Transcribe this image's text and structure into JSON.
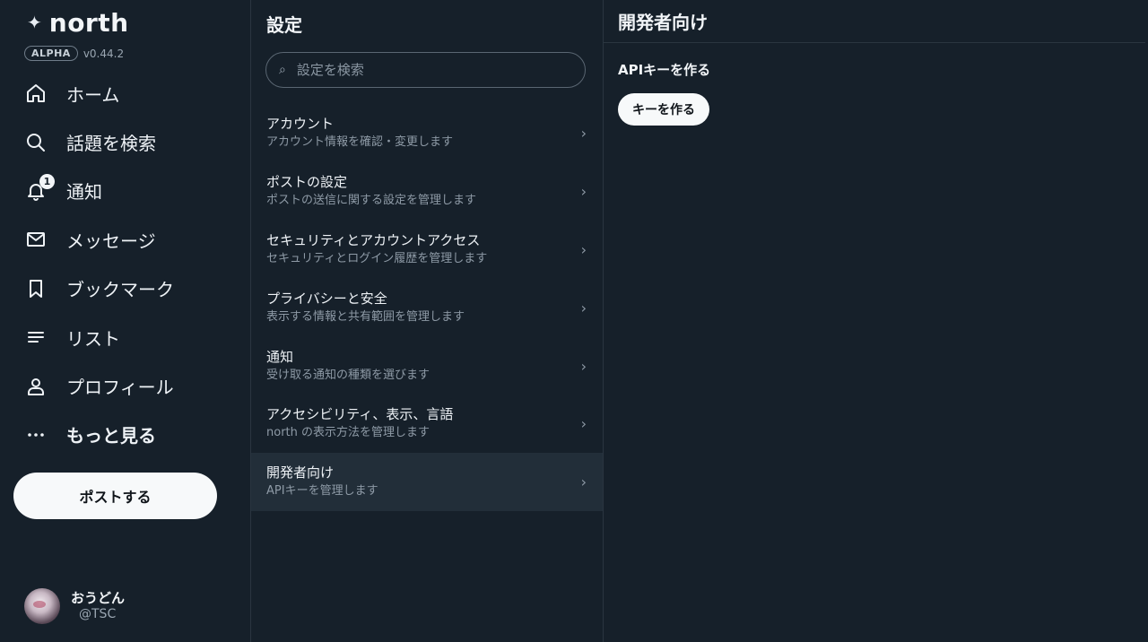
{
  "app": {
    "name": "north",
    "badge": "ALPHA",
    "version": "v0.44.2"
  },
  "nav": [
    {
      "label": "ホーム",
      "icon": "home-icon"
    },
    {
      "label": "話題を検索",
      "icon": "search-icon"
    },
    {
      "label": "通知",
      "icon": "bell-icon",
      "count": "1"
    },
    {
      "label": "メッセージ",
      "icon": "mail-icon"
    },
    {
      "label": "ブックマーク",
      "icon": "bookmark-icon"
    },
    {
      "label": "リスト",
      "icon": "list-icon"
    },
    {
      "label": "プロフィール",
      "icon": "person-icon"
    },
    {
      "label": "もっと見る",
      "icon": "more-icon"
    }
  ],
  "post_button": "ポストする",
  "user": {
    "name": "おうどん",
    "handle": "@TSC"
  },
  "settings": {
    "title": "設定",
    "search_placeholder": "設定を検索",
    "items": [
      {
        "title": "アカウント",
        "subtitle": "アカウント情報を確認・変更します"
      },
      {
        "title": "ポストの設定",
        "subtitle": "ポストの送信に関する設定を管理します"
      },
      {
        "title": "セキュリティとアカウントアクセス",
        "subtitle": "セキュリティとログイン履歴を管理します"
      },
      {
        "title": "プライバシーと安全",
        "subtitle": "表示する情報と共有範囲を管理します"
      },
      {
        "title": "通知",
        "subtitle": "受け取る通知の種類を選びます"
      },
      {
        "title": "アクセシビリティ、表示、言語",
        "subtitle": "north の表示方法を管理します"
      },
      {
        "title": "開発者向け",
        "subtitle": "APIキーを管理します",
        "active": true
      }
    ]
  },
  "developer": {
    "title": "開発者向け",
    "section_title": "APIキーを作る",
    "create_button": "キーを作る"
  },
  "colors": {
    "background": "#16202a",
    "active_row": "#222e39",
    "button": "#f7f9fa"
  }
}
